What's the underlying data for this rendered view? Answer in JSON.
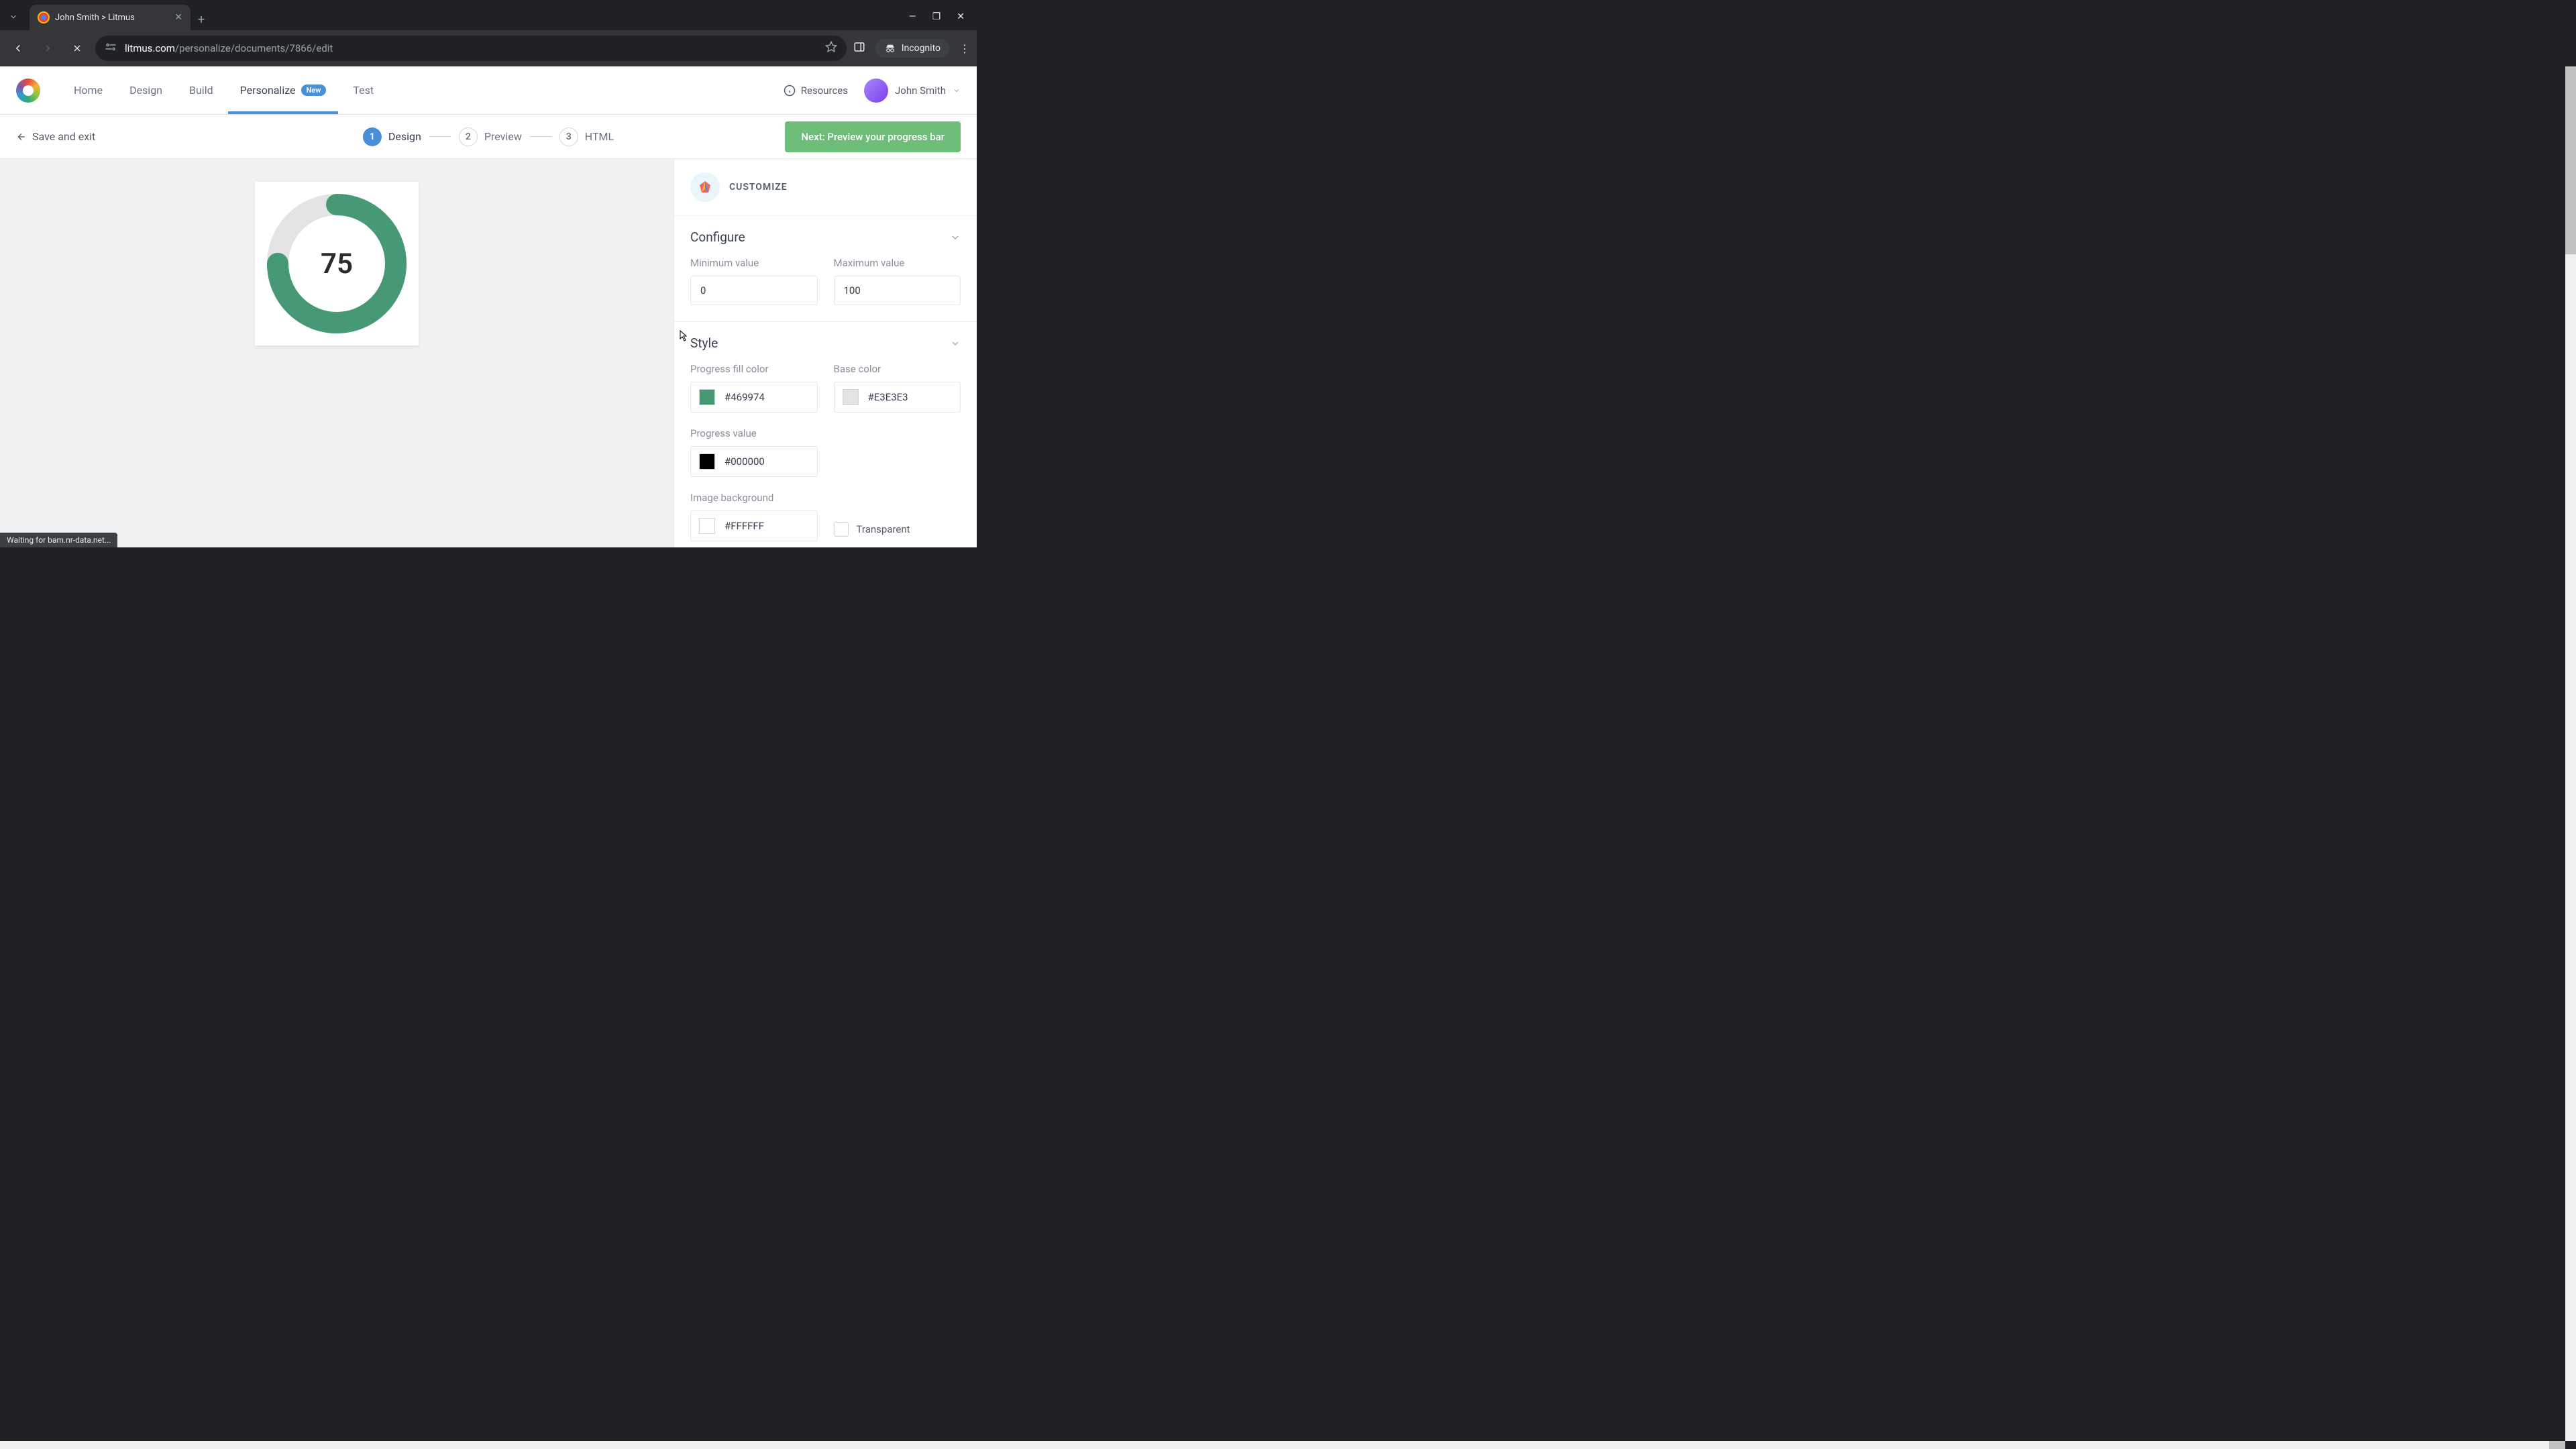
{
  "browser": {
    "tab_title": "John Smith > Litmus",
    "url_domain": "litmus.com",
    "url_path": "/personalize/documents/7866/edit",
    "incognito_label": "Incognito",
    "status_text": "Waiting for bam.nr-data.net..."
  },
  "header": {
    "nav": {
      "home": "Home",
      "design": "Design",
      "build": "Build",
      "personalize": "Personalize",
      "personalize_badge": "New",
      "test": "Test"
    },
    "resources_label": "Resources",
    "user_name": "John Smith"
  },
  "subheader": {
    "save_exit": "Save and exit",
    "steps": {
      "s1_num": "1",
      "s1_label": "Design",
      "s2_num": "2",
      "s2_label": "Preview",
      "s3_num": "3",
      "s3_label": "HTML"
    },
    "next_button": "Next: Preview your progress bar"
  },
  "preview": {
    "value_text": "75"
  },
  "sidebar": {
    "title": "CUSTOMIZE",
    "configure": {
      "title": "Configure",
      "min_label": "Minimum value",
      "min_value": "0",
      "max_label": "Maximum value",
      "max_value": "100"
    },
    "style": {
      "title": "Style",
      "fill_label": "Progress fill color",
      "fill_hex": "#469974",
      "base_label": "Base color",
      "base_hex": "#E3E3E3",
      "value_label": "Progress value",
      "value_hex": "#000000",
      "bg_label": "Image background",
      "bg_hex": "#FFFFFF",
      "transparent_label": "Transparent"
    }
  },
  "colors": {
    "fill": "#469974",
    "base": "#E3E3E3",
    "value": "#000000",
    "bg": "#FFFFFF",
    "accent_blue": "#4a90d9",
    "accent_green": "#6ebe7a"
  },
  "chart_data": {
    "type": "pie",
    "title": "",
    "value": 75,
    "min": 0,
    "max": 100,
    "fill_color": "#469974",
    "base_color": "#E3E3E3",
    "center_label": "75"
  }
}
